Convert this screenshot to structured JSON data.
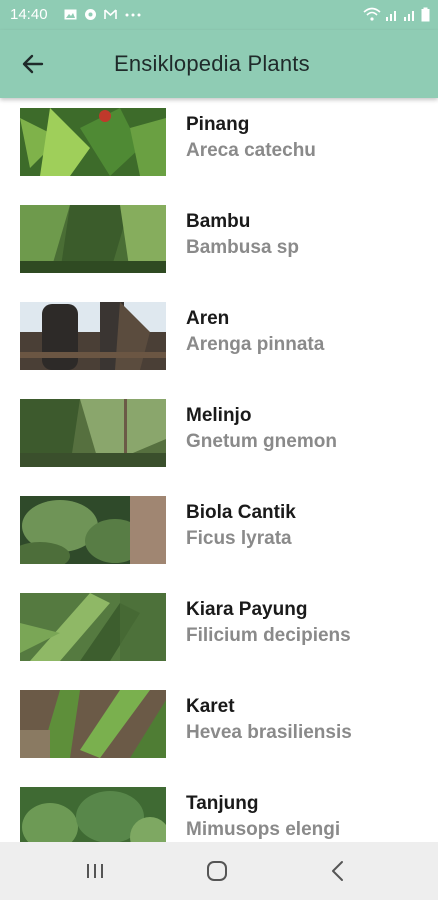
{
  "status_bar": {
    "time": "14:40",
    "left_icons": [
      "gallery-icon",
      "location-icon",
      "mail-icon",
      "more-dots-icon"
    ],
    "right_icons": [
      "wifi-icon",
      "signal-icon",
      "signal-icon",
      "battery-icon"
    ]
  },
  "app_bar": {
    "back_icon": "arrow-left-icon",
    "title": "Ensiklopedia Plants"
  },
  "plants": [
    {
      "name": "Pinang",
      "latin": "Areca catechu"
    },
    {
      "name": "Bambu",
      "latin": "Bambusa sp"
    },
    {
      "name": "Aren",
      "latin": "Arenga pinnata"
    },
    {
      "name": "Melinjo",
      "latin": "Gnetum gnemon"
    },
    {
      "name": "Biola Cantik",
      "latin": "Ficus lyrata"
    },
    {
      "name": "Kiara Payung",
      "latin": "Filicium decipiens"
    },
    {
      "name": "Karet",
      "latin": "Hevea brasiliensis"
    },
    {
      "name": "Tanjung",
      "latin": "Mimusops elengi"
    }
  ],
  "nav_bar": {
    "items": [
      "recent-apps-icon",
      "home-icon",
      "back-icon"
    ]
  },
  "colors": {
    "app_bar": "#8fccb4",
    "plant_name": "#1a1a1a",
    "latin_name": "#8a8a8a",
    "nav_bar": "#eeeeee"
  }
}
